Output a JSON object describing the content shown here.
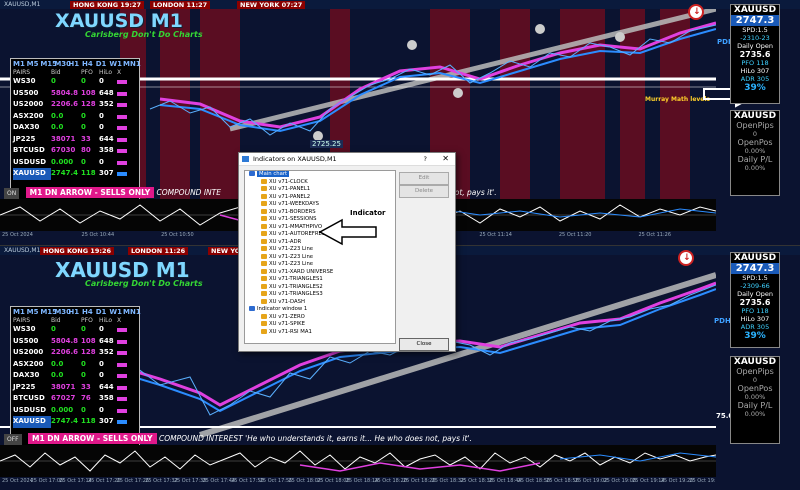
{
  "charts": [
    {
      "window_title": "XAUUSD,M1",
      "symbol_title": "XAUUSD M1",
      "subtitle": "Carlsberg Don't Do Charts",
      "sessions": {
        "hk": "HONG KONG 19:27",
        "london": "LONDON 11:27",
        "ny": "NEW YORK 07:27"
      },
      "status_off": "ON",
      "status_dn": "M1  DN ARROW - SELLS ONLY",
      "status_text": "COMPOUND INTE",
      "status_tail": "not, pays it'.",
      "price_tag": "2725.25",
      "murray": "Murray Math levels",
      "pdh": "PDH",
      "panel": {
        "symbol": "XAUUSD",
        "price": "2747.3",
        "spd": "SPD:1.5",
        "change": "-2310-23",
        "daily_open_label": "Daily Open",
        "daily_open": "2735.6",
        "pfo": "PFO 118",
        "hilo": "HiLo 307",
        "adr": "ADR 305",
        "adr_pct": "39%"
      },
      "pnl": {
        "symbol": "XAUUSD",
        "open_pips_label": "OpenPips",
        "open_pips": "0",
        "open_pos_label": "OpenPos",
        "open_pos": "0.00%",
        "daily_pl_label": "Daily P/L",
        "daily_pl": "0.00%"
      }
    },
    {
      "window_title": "XAUUSD,M1",
      "symbol_title": "XAUUSD M1",
      "subtitle": "Carlsberg Don't Do Charts",
      "sessions": {
        "hk": "HONG KONG 19:26",
        "london": "LONDON 11:26",
        "ny": "NEW YORK 07:26"
      },
      "status_off": "OFF",
      "status_dn": "M1  DN ARROW - SELLS ONLY",
      "status_text": "COMPOUND INTEREST 'He who understands it, earns it... He who does not, pays it'.",
      "pdh": "PDH",
      "level_75": "75.0",
      "panel": {
        "symbol": "XAUUSD",
        "price": "2747.3",
        "spd": "SPD:1.5",
        "change": "-2309-66",
        "daily_open_label": "Daily Open",
        "daily_open": "2735.6",
        "pfo": "PFO 118",
        "hilo": "HiLo 307",
        "adr": "ADR 305",
        "adr_pct": "39%"
      },
      "pnl": {
        "symbol": "XAUUSD",
        "open_pips_label": "OpenPips",
        "open_pips": "0",
        "open_pos_label": "OpenPos",
        "open_pos": "0.00%",
        "daily_pl_label": "Daily P/L",
        "daily_pl": "0.00%"
      }
    }
  ],
  "market_table": {
    "timeframes": [
      "M1",
      "M5",
      "M15",
      "M30",
      "H1",
      "H4",
      "D1",
      "W1",
      "MN1"
    ],
    "columns": [
      "PAIRS",
      "Bid",
      "PFO",
      "HiLo",
      "X"
    ],
    "rows": [
      {
        "pair": "WS30",
        "bid": "0",
        "pfo": "0",
        "hilo": "0",
        "bid_color": "#20e020",
        "swatch": "#e040e0"
      },
      {
        "pair": "US500",
        "bid": "5804.8",
        "pfo": "108",
        "hilo": "648",
        "bid_color": "#e040e0",
        "swatch": "#e040e0"
      },
      {
        "pair": "US2000",
        "bid": "2206.6",
        "pfo": "128",
        "hilo": "352",
        "bid_color": "#e040e0",
        "swatch": "#e040e0"
      },
      {
        "pair": "ASX200",
        "bid": "0.0",
        "pfo": "0",
        "hilo": "0",
        "bid_color": "#20e020",
        "swatch": "#e040e0"
      },
      {
        "pair": "DAX30",
        "bid": "0.0",
        "pfo": "0",
        "hilo": "0",
        "bid_color": "#20e020",
        "swatch": "#e040e0"
      },
      {
        "pair": "JP225",
        "bid": "38071",
        "pfo": "33",
        "hilo": "644",
        "bid_color": "#e040e0",
        "swatch": "#e040e0"
      },
      {
        "pair": "BTCUSD",
        "bid": "67030",
        "pfo": "80",
        "hilo": "358",
        "bid_color": "#e040e0",
        "swatch": "#e040e0"
      },
      {
        "pair": "USDUSD",
        "bid": "0.000",
        "pfo": "0",
        "hilo": "0",
        "bid_color": "#20e020",
        "swatch": "#e040e0"
      },
      {
        "pair": "XAUUSD",
        "bid": "2747.4",
        "pfo": "118",
        "hilo": "307",
        "bid_color": "#20e020",
        "swatch": "#2b8cff"
      }
    ]
  },
  "table2_bids": [
    "0",
    "5804.8",
    "2206.6",
    "0.0",
    "0.0",
    "38071",
    "67027",
    "0.000",
    "2747.4"
  ],
  "table2_pfo": [
    "0",
    "108",
    "128",
    "0",
    "0",
    "33",
    "76",
    "0",
    "118"
  ],
  "dialog": {
    "title": "Indicators on XAUUSD,M1",
    "help": "?",
    "close_x": "✕",
    "tree": [
      {
        "label": "Main chart",
        "type": "root",
        "selected": true
      },
      {
        "label": "XU v71-CLOCK",
        "type": "ind"
      },
      {
        "label": "XU v71-PANEL1",
        "type": "ind"
      },
      {
        "label": "XU v71-PANEL2",
        "type": "ind"
      },
      {
        "label": "XU v71-WEEKDAYS",
        "type": "ind"
      },
      {
        "label": "XU v71-BORDERS",
        "type": "ind"
      },
      {
        "label": "XU v71-SESSIONS",
        "type": "ind"
      },
      {
        "label": "XU v71-MMATHPIVO",
        "type": "ind"
      },
      {
        "label": "XU v71-AUTOREFRESH",
        "type": "ind"
      },
      {
        "label": "XU v71-ADR",
        "type": "ind"
      },
      {
        "label": "XU v71-Z23 Line",
        "type": "ind"
      },
      {
        "label": "XU v71-Z23 Line",
        "type": "ind"
      },
      {
        "label": "XU v71-Z23 Line",
        "type": "ind"
      },
      {
        "label": "XU v71-XARD UNIVERSE",
        "type": "ind"
      },
      {
        "label": "XU v71-TRIANGLES1",
        "type": "ind"
      },
      {
        "label": "XU v71-TRIANGLES2",
        "type": "ind"
      },
      {
        "label": "XU v71-TRIANGLES3",
        "type": "ind"
      },
      {
        "label": "XU v71-DASH",
        "type": "ind"
      },
      {
        "label": "Indicator window 1",
        "type": "root"
      },
      {
        "label": "XU v71-ZERO",
        "type": "ind"
      },
      {
        "label": "XU v71-SPIKE",
        "type": "ind"
      },
      {
        "label": "XU v71-RSI MA1",
        "type": "ind"
      }
    ],
    "buttons": {
      "edit": "Edit",
      "delete": "Delete",
      "close": "Close"
    }
  },
  "annotation": {
    "label": "Indicator"
  },
  "x_axis_labels": [
    "25 Oct 2024",
    "25 Oct 10:44",
    "25 Oct 10:50",
    "25 Oct 10:56",
    "25 Oct 11:02",
    "25 Oct 11:08",
    "25 Oct 11:14",
    "25 Oct 11:20",
    "25 Oct 11:26"
  ],
  "x_axis_labels_2": [
    "25 Oct 2024",
    "25 Oct 17:08",
    "25 Oct 17:14",
    "25 Oct 17:20",
    "25 Oct 17:26",
    "25 Oct 17:32",
    "25 Oct 17:38",
    "25 Oct 17:44",
    "25 Oct 17:50",
    "25 Oct 17:56",
    "25 Oct 18:02",
    "25 Oct 18:08",
    "25 Oct 18:14",
    "25 Oct 18:20",
    "25 Oct 18:26",
    "25 Oct 18:32",
    "25 Oct 18:38",
    "25 Oct 18:44",
    "25 Oct 18:50",
    "25 Oct 18:56",
    "25 Oct 19:02",
    "25 Oct 19:08",
    "25 Oct 19:14",
    "25 Oct 19:20",
    "25 Oct 19:26"
  ],
  "colors": {
    "bullish": "#2b8cff",
    "bearish": "#e040e0",
    "band": "#5a0d22",
    "accent": "#3fd1ff"
  }
}
